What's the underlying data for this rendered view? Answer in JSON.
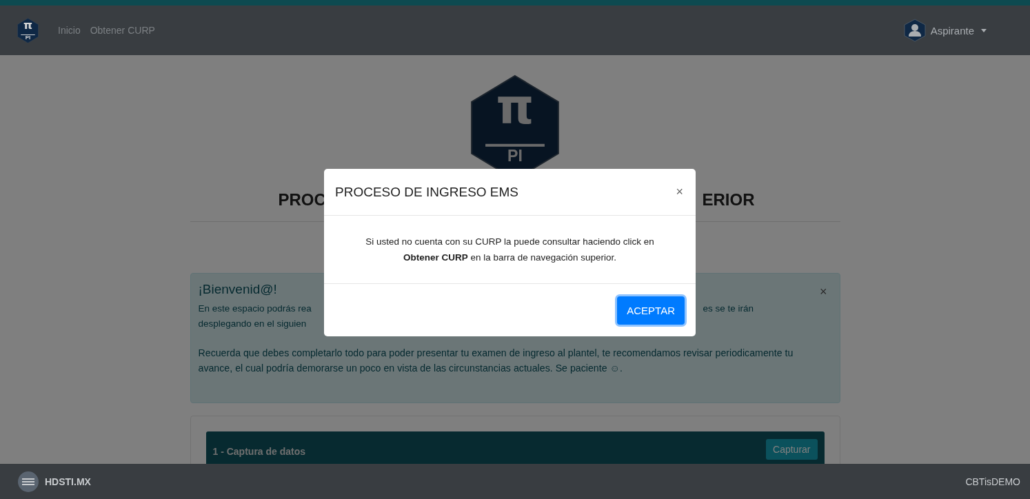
{
  "navbar": {
    "logo": {
      "symbol": "π",
      "label": "PI"
    },
    "links": [
      "Inicio",
      "Obtener CURP"
    ],
    "user": "Aspirante"
  },
  "page": {
    "logo": {
      "symbol": "π",
      "label": "PI"
    },
    "heading_parts": [
      "PROC",
      "ERIOR"
    ],
    "welcome": {
      "title": "¡Bienvenid@!",
      "close": "×",
      "line_parts": [
        [
          "En este espacio podrás rea",
          "es se te irán"
        ],
        [
          "desplegando en el siguien"
        ]
      ],
      "paragraph": "Recuerda que debes completarlo todo para poder presentar tu examen de ingreso al plantel, te recomendamos revisar periodicamente tu avance, el cual podría demorarse un poco en vista de las circunstancias actuales. Se paciente ☺."
    },
    "steps": [
      {
        "title": "1 - Captura de datos",
        "button": "Capturar"
      }
    ]
  },
  "modal": {
    "title": "PROCESO DE INGRESO EMS",
    "close": "×",
    "body": "Si usted no cuenta con su CURP la puede consultar haciendo click en **Obtener CURP** en la barra de navegación superior.",
    "button": "ACEPTAR"
  },
  "footer": {
    "left": "HDSTI.MX",
    "right": "CBTisDEMO"
  }
}
